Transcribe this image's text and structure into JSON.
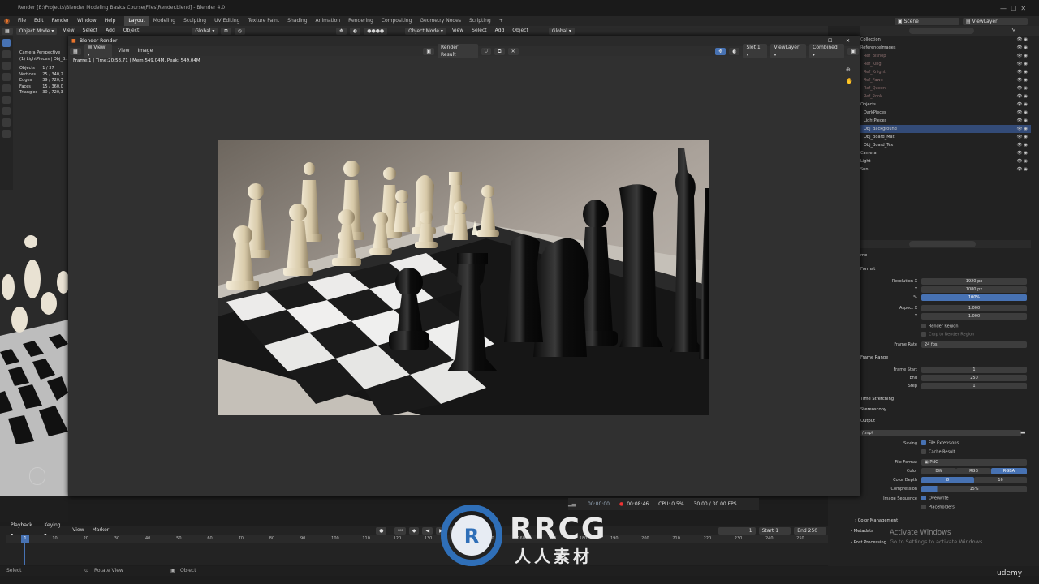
{
  "title_bar": {
    "text": "Render [E:\\Projects\\Blender Modeling Basics Course\\Files\\Render.blend] - Blender 4.0"
  },
  "menu": [
    "File",
    "Edit",
    "Render",
    "Window",
    "Help"
  ],
  "workspaces": [
    "Layout",
    "Modeling",
    "Sculpting",
    "UV Editing",
    "Texture Paint",
    "Shading",
    "Animation",
    "Rendering",
    "Compositing",
    "Geometry Nodes",
    "Scripting"
  ],
  "workspace_add": "+",
  "scene": {
    "scene_label": "Scene",
    "view_layer_label": "ViewLayer"
  },
  "header3d": {
    "mode": "Object Mode",
    "items": [
      "View",
      "Select",
      "Add",
      "Object"
    ],
    "orientation": "Global"
  },
  "header3d_right": {
    "mode": "Object Mode",
    "items": [
      "View",
      "Select",
      "Add",
      "Object"
    ],
    "orientation": "Global"
  },
  "viewport": {
    "camera_label": "Camera Perspective",
    "selection_label": "(1) LightPieces | Obj_B...",
    "stats": [
      {
        "k": "Objects",
        "v": "1 / 37"
      },
      {
        "k": "Vertices",
        "v": "25 / 340,2"
      },
      {
        "k": "Edges",
        "v": "39 / 720,3"
      },
      {
        "k": "Faces",
        "v": "15 / 360,0"
      },
      {
        "k": "Triangles",
        "v": "30 / 720,3"
      }
    ]
  },
  "render_window": {
    "title": "Blender Render",
    "menu": [
      "View",
      "View",
      "Image"
    ],
    "image_name": "Render Result",
    "slot": "Slot 1",
    "view_layer": "ViewLayer",
    "pass": "Combined",
    "frame_info": "Frame:1 | Time:20:58.71 | Mem:549.04M, Peak: 549.04M"
  },
  "render_bar": {
    "time1": "00:00:00",
    "time2": "00:08:46",
    "cpu": "CPU: 0.5%",
    "fps": "30.00 / 30.00 FPS"
  },
  "timeline": {
    "menu": [
      "Playback",
      "Keying",
      "View",
      "Marker"
    ],
    "current_frame": "1",
    "start_label": "Start",
    "start": "1",
    "end_label": "End",
    "end": "250",
    "ticks": [
      "10",
      "20",
      "30",
      "40",
      "50",
      "60",
      "70",
      "80",
      "90",
      "100",
      "110",
      "120",
      "130",
      "140",
      "150",
      "160",
      "170",
      "180",
      "190",
      "200",
      "210",
      "220",
      "230",
      "240",
      "250"
    ],
    "playhead": "1"
  },
  "status_bar": {
    "select": "Select",
    "rotate": "Rotate View",
    "object": "Object"
  },
  "outliner": {
    "items": [
      {
        "label": "Collection",
        "indent": 0
      },
      {
        "label": "ReferenceImages",
        "indent": 0
      },
      {
        "label": "Ref_Bishop",
        "indent": 1
      },
      {
        "label": "Ref_King",
        "indent": 1
      },
      {
        "label": "Ref_Knight",
        "indent": 1
      },
      {
        "label": "Ref_Pawn",
        "indent": 1
      },
      {
        "label": "Ref_Queen",
        "indent": 1
      },
      {
        "label": "Ref_Rook",
        "indent": 1
      },
      {
        "label": "Objects",
        "indent": 0
      },
      {
        "label": "DarkPieces",
        "indent": 1
      },
      {
        "label": "LightPieces",
        "indent": 1
      },
      {
        "label": "Obj_Background",
        "indent": 1,
        "selected": true
      },
      {
        "label": "Obj_Board_Mat",
        "indent": 1
      },
      {
        "label": "Obj_Board_Tex",
        "indent": 1
      },
      {
        "label": "Camera",
        "indent": 0
      },
      {
        "label": "Light",
        "indent": 0
      },
      {
        "label": "Sun",
        "indent": 0
      }
    ]
  },
  "properties": {
    "format_section": "Format",
    "resolution_x_label": "Resolution X",
    "resolution_x": "1920 px",
    "resolution_y_label": "Y",
    "resolution_y": "1080 px",
    "percent_label": "%",
    "percent": "100%",
    "aspect_x_label": "Aspect X",
    "aspect_x": "1.000",
    "aspect_y_label": "Y",
    "aspect_y": "1.000",
    "render_region": "Render Region",
    "crop_region": "Crop to Render Region",
    "frame_rate_label": "Frame Rate",
    "frame_rate": "24 fps",
    "frame_range_section": "Frame Range",
    "frame_start_label": "Frame Start",
    "frame_start": "1",
    "end_label": "End",
    "end": "250",
    "step_label": "Step",
    "step": "1",
    "time_stretching": "Time Stretching",
    "stereoscopy": "Stereoscopy",
    "output_section": "Output",
    "output_path": "/tmp\\",
    "saving_label": "Saving",
    "file_extensions": "File Extensions",
    "cache_result": "Cache Result",
    "file_format_label": "File Format",
    "file_format": "PNG",
    "color_label": "Color",
    "color_options": [
      "BW",
      "RGB",
      "RGBA"
    ],
    "color_depth_label": "Color Depth",
    "color_depth_options": [
      "8",
      "16"
    ],
    "compression_label": "Compression",
    "compression": "15%",
    "image_sequence_label": "Image Sequence",
    "overwrite": "Overwrite",
    "placeholders": "Placeholders",
    "color_management": "Color Management",
    "metadata": "Metadata",
    "post_processing": "Post Processing"
  },
  "overlay": {
    "activate_title": "Activate Windows",
    "activate_sub": "Go to Settings to activate Windows.",
    "watermark_main": "RRCG",
    "watermark_sub": "人人素材",
    "udemy": "udemy"
  },
  "colors": {
    "accent": "#4772b3",
    "selected_row": "#334b78",
    "bg": "#1d1d1d",
    "panel": "#303030"
  }
}
